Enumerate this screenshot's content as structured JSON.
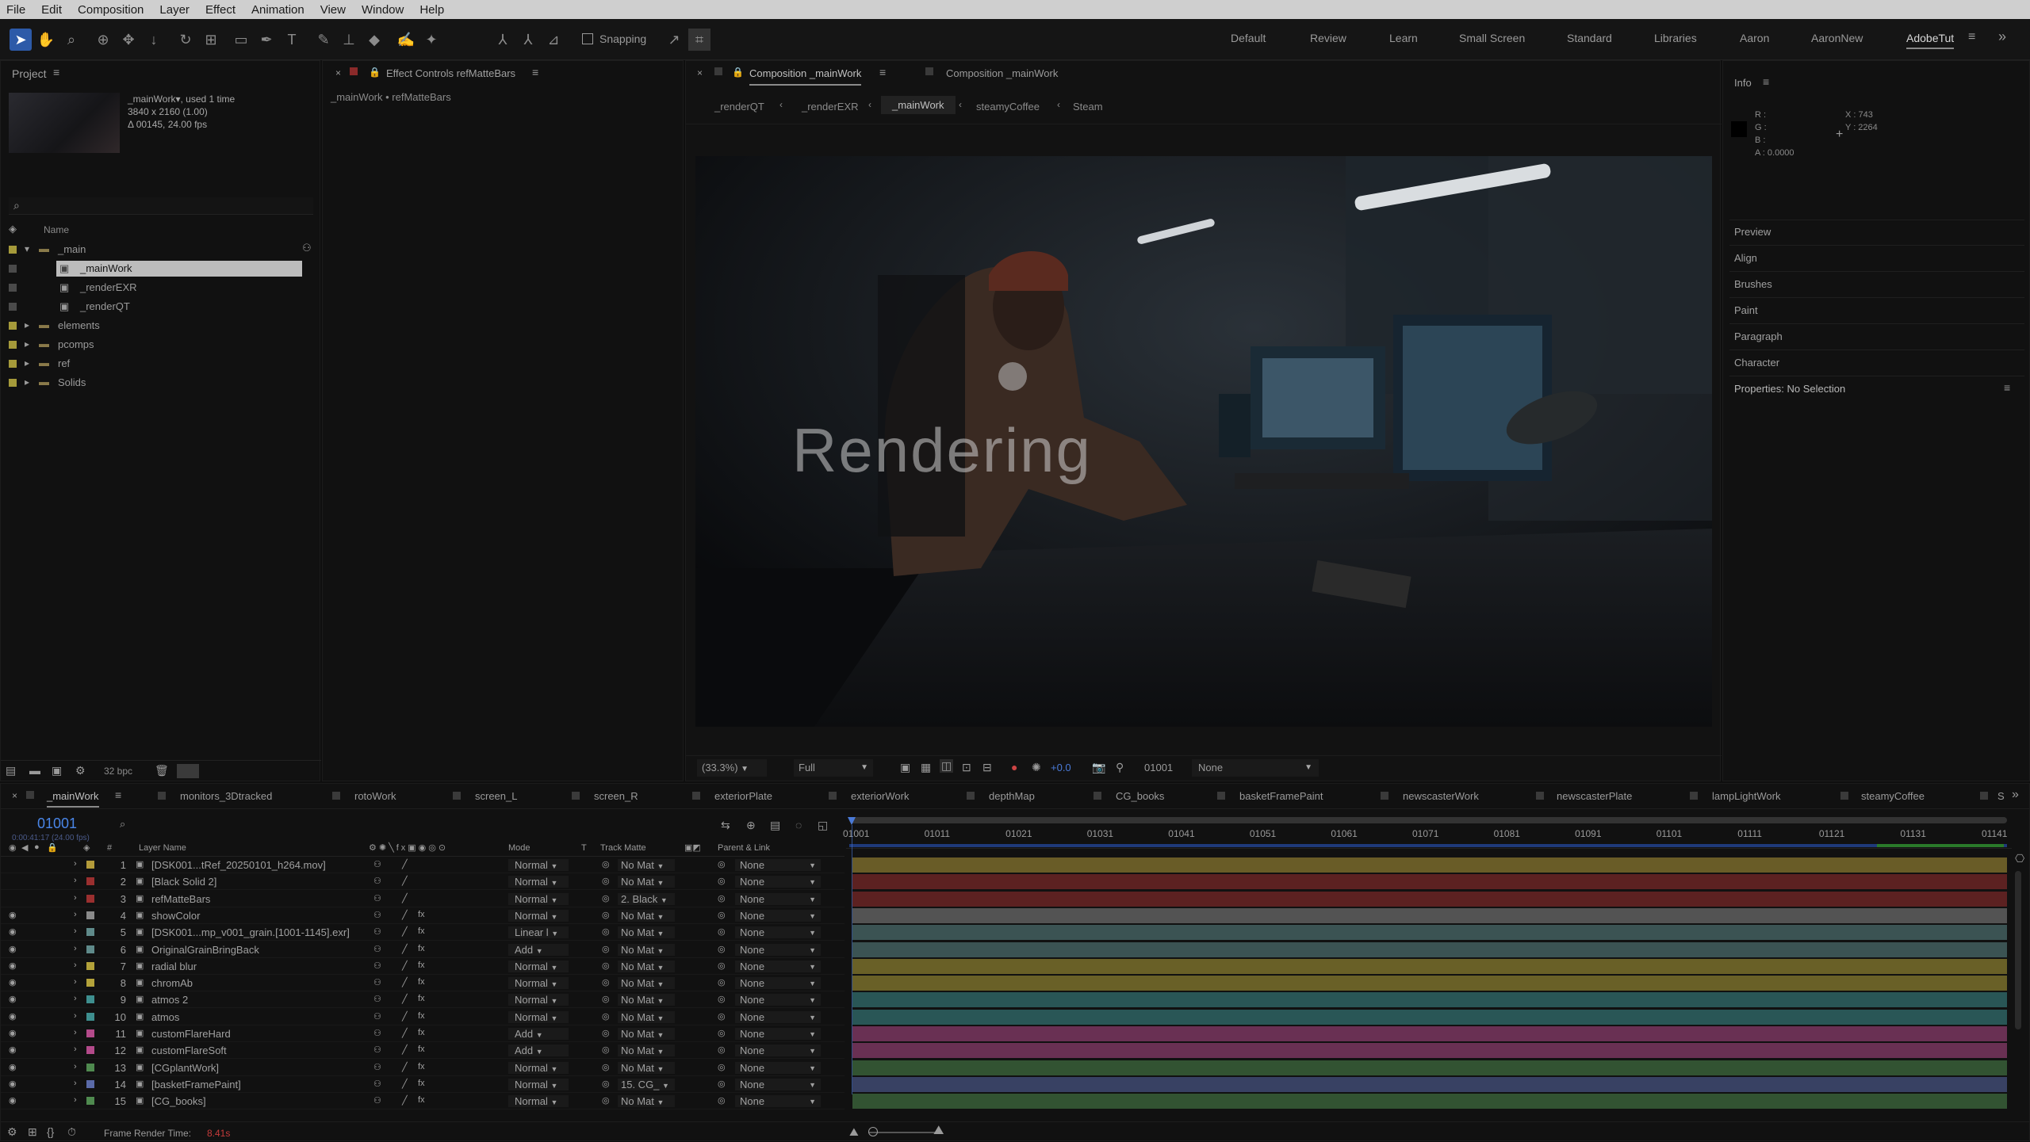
{
  "menu": [
    "File",
    "Edit",
    "Composition",
    "Layer",
    "Effect",
    "Animation",
    "View",
    "Window",
    "Help"
  ],
  "toolbar": {
    "snapping": "Snapping"
  },
  "workspaces": [
    "Default",
    "Review",
    "Learn",
    "Small Screen",
    "Standard",
    "Libraries",
    "Aaron",
    "AaronNew",
    "AdobeTut"
  ],
  "project": {
    "title": "Project",
    "comp_name": "_mainWork▾",
    "used": ", used 1 time",
    "dims": "3840 x 2160 (1.00)",
    "duration": "Δ 00145, 24.00 fps",
    "col_name": "Name",
    "bpc": "32 bpc",
    "items": [
      {
        "label": "_main",
        "type": "folder",
        "open": true
      },
      {
        "label": "_mainWork",
        "type": "comp",
        "selected": true
      },
      {
        "label": "_renderEXR",
        "type": "comp"
      },
      {
        "label": "_renderQT",
        "type": "comp"
      },
      {
        "label": "elements",
        "type": "folder"
      },
      {
        "label": "pcomps",
        "type": "folder"
      },
      {
        "label": "ref",
        "type": "folder"
      },
      {
        "label": "Solids",
        "type": "folder"
      }
    ]
  },
  "effect": {
    "title": "Effect Controls refMatteBars",
    "path": "_mainWork • refMatteBars"
  },
  "comp": {
    "tab1": "Composition _mainWork",
    "tab2": "Composition _mainWork",
    "nav": [
      "_renderQT",
      "_renderEXR",
      "_mainWork",
      "steamyCoffee",
      "Steam"
    ],
    "overlay": "Rendering",
    "zoom": "(33.3%)",
    "res": "Full",
    "frame": "01001",
    "view": "None",
    "exposure": "+0.0"
  },
  "info": {
    "title": "Info",
    "r": "R :",
    "g": "G :",
    "b": "B :",
    "a": "A : 0.0000",
    "x": "X : 743",
    "y": "Y : 2264",
    "panels": [
      "Preview",
      "Align",
      "Brushes",
      "Paint",
      "Paragraph",
      "Character"
    ],
    "properties": "Properties: No Selection"
  },
  "timeline": {
    "tabs": [
      "_mainWork",
      "monitors_3Dtracked",
      "rotoWork",
      "screen_L",
      "screen_R",
      "exteriorPlate",
      "exteriorWork",
      "depthMap",
      "CG_books",
      "basketFramePaint",
      "newscasterWork",
      "newscasterPlate",
      "lampLightWork",
      "steamyCoffee",
      "S"
    ],
    "timecode": "01001",
    "timecode_sub": "0:00:41:17 (24.00 fps)",
    "headers": {
      "hash": "#",
      "layer_name": "Layer Name",
      "mode": "Mode",
      "t": "T",
      "track_matte": "Track Matte",
      "parent": "Parent & Link"
    },
    "ruler": [
      "01001",
      "01011",
      "01021",
      "01031",
      "01041",
      "01051",
      "01061",
      "01071",
      "01081",
      "01091",
      "01101",
      "01111",
      "01121",
      "01131",
      "01141"
    ],
    "layers": [
      {
        "n": "1",
        "name": "[DSK001...tRef_20250101_h264.mov]",
        "mode": "Normal",
        "matte": "No Mat",
        "parent": "None",
        "color": "#b39b3a"
      },
      {
        "n": "2",
        "name": "[Black Solid 2]",
        "mode": "Normal",
        "matte": "No Mat",
        "parent": "None",
        "color": "#9a2f2f"
      },
      {
        "n": "3",
        "name": "refMatteBars",
        "mode": "Normal",
        "matte": "2. Black",
        "parent": "None",
        "color": "#9a2f2f"
      },
      {
        "n": "4",
        "name": "showColor",
        "mode": "Normal",
        "matte": "No Mat",
        "parent": "None",
        "color": "#8a8a8a"
      },
      {
        "n": "5",
        "name": "[DSK001...mp_v001_grain.[1001-1145].exr]",
        "mode": "Linear l",
        "matte": "No Mat",
        "parent": "None",
        "color": "#5f8a8a"
      },
      {
        "n": "6",
        "name": "OriginalGrainBringBack",
        "mode": "Add",
        "matte": "No Mat",
        "parent": "None",
        "color": "#5f8a8a"
      },
      {
        "n": "7",
        "name": "radial blur",
        "mode": "Normal",
        "matte": "No Mat",
        "parent": "None",
        "color": "#b3a23a"
      },
      {
        "n": "8",
        "name": "chromAb",
        "mode": "Normal",
        "matte": "No Mat",
        "parent": "None",
        "color": "#b3a23a"
      },
      {
        "n": "9",
        "name": "atmos 2",
        "mode": "Normal",
        "matte": "No Mat",
        "parent": "None",
        "color": "#3e8f8f"
      },
      {
        "n": "10",
        "name": "atmos",
        "mode": "Normal",
        "matte": "No Mat",
        "parent": "None",
        "color": "#3e8f8f"
      },
      {
        "n": "11",
        "name": "customFlareHard",
        "mode": "Add",
        "matte": "No Mat",
        "parent": "None",
        "color": "#b34a8a"
      },
      {
        "n": "12",
        "name": "customFlareSoft",
        "mode": "Add",
        "matte": "No Mat",
        "parent": "None",
        "color": "#b34a8a"
      },
      {
        "n": "13",
        "name": "[CGplantWork]",
        "mode": "Normal",
        "matte": "No Mat",
        "parent": "None",
        "color": "#4f8a4f"
      },
      {
        "n": "14",
        "name": "[basketFramePaint]",
        "mode": "Normal",
        "matte": "15. CG_",
        "parent": "None",
        "color": "#5a6aa8"
      },
      {
        "n": "15",
        "name": "[CG_books]",
        "mode": "Normal",
        "matte": "No Mat",
        "parent": "None",
        "color": "#4f8a4f"
      }
    ],
    "render_label": "Frame Render Time:",
    "render_time": "8.41s"
  },
  "colors": {
    "accent": "#2d5aa8",
    "selected": "#bcbcbc"
  }
}
